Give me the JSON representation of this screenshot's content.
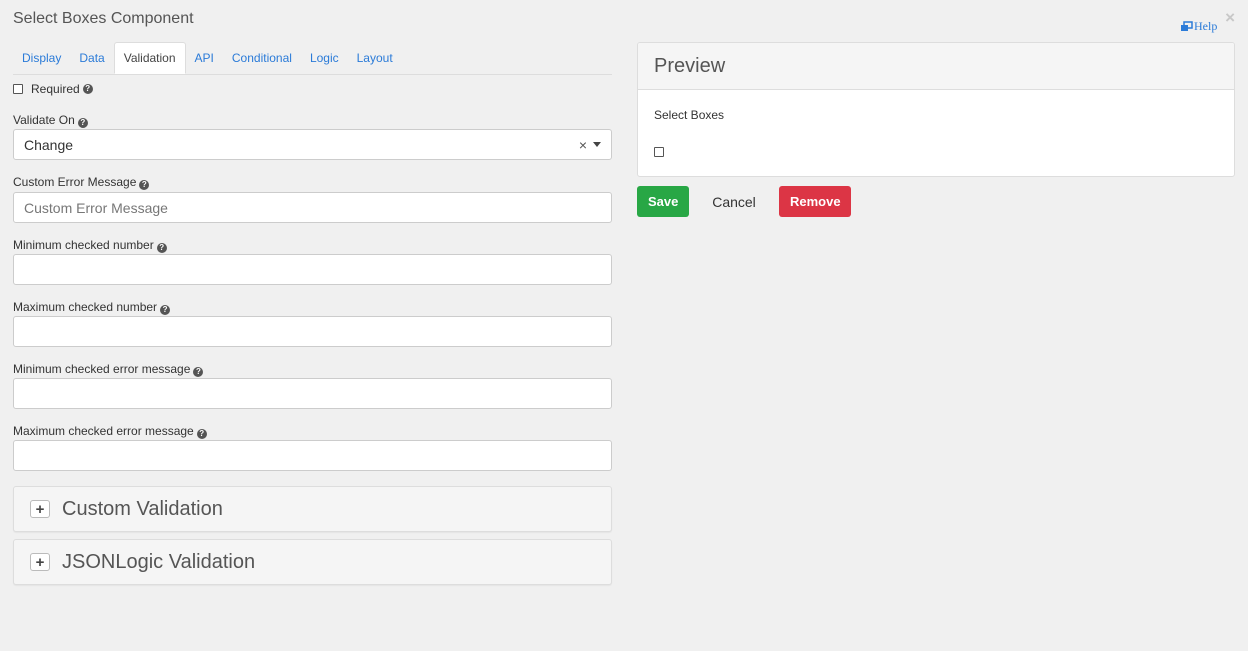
{
  "window": {
    "title": "Select Boxes Component",
    "close_label": "×",
    "help_label": "Help"
  },
  "tabs": [
    {
      "label": "Display"
    },
    {
      "label": "Data"
    },
    {
      "label": "Validation",
      "active": true
    },
    {
      "label": "API"
    },
    {
      "label": "Conditional"
    },
    {
      "label": "Logic"
    },
    {
      "label": "Layout"
    }
  ],
  "form": {
    "required_label": "Required",
    "validate_on_label": "Validate On",
    "validate_on_value": "Change",
    "custom_error_label": "Custom Error Message",
    "custom_error_placeholder": "Custom Error Message",
    "min_checked_label": "Minimum checked number",
    "max_checked_label": "Maximum checked number",
    "min_error_label": "Minimum checked error message",
    "max_error_label": "Maximum checked error message",
    "clear_glyph": "×",
    "help_glyph": "?"
  },
  "panels": [
    {
      "title": "Custom Validation",
      "toggle": "+"
    },
    {
      "title": "JSONLogic Validation",
      "toggle": "+"
    }
  ],
  "preview": {
    "title": "Preview",
    "component_label": "Select Boxes"
  },
  "actions": {
    "save": "Save",
    "cancel": "Cancel",
    "remove": "Remove"
  },
  "colors": {
    "link": "#2b7bd8",
    "save": "#28a745",
    "remove": "#dc3545"
  },
  "icons": {
    "help_window": "external-window-icon",
    "question": "question-circle-icon",
    "close": "close-icon",
    "caret": "caret-down-icon",
    "plus": "plus-icon"
  }
}
